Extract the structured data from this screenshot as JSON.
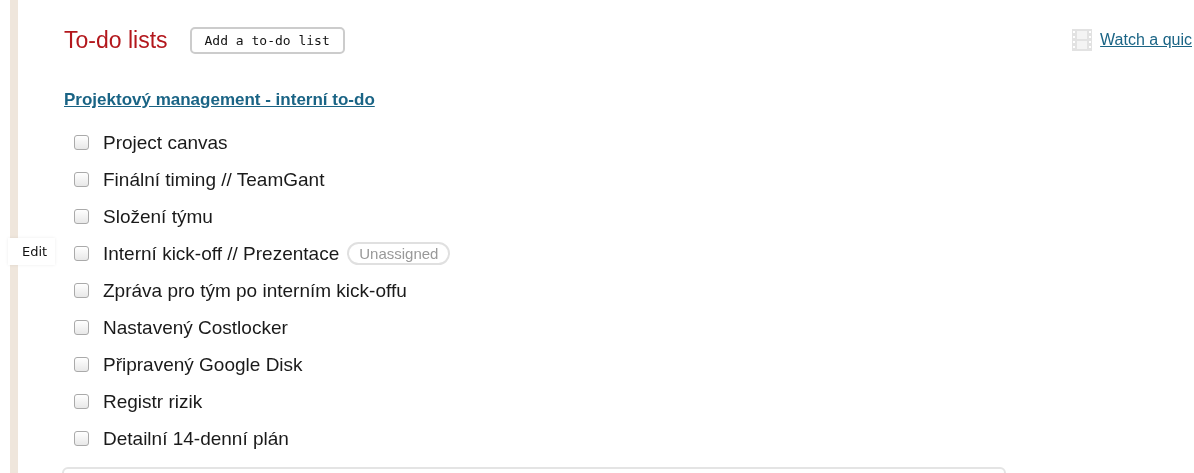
{
  "header": {
    "title": "To-do lists",
    "add_button": "Add a to-do list",
    "video_link": "Watch a quic"
  },
  "list": {
    "title": "Projektový management - interní to-do",
    "items": [
      {
        "label": "Project canvas",
        "checked": false
      },
      {
        "label": "Finální timing // TeamGant",
        "checked": false
      },
      {
        "label": "Složení týmu",
        "checked": false
      },
      {
        "label": "Interní kick-off // Prezentace",
        "checked": false,
        "badge": "Unassigned",
        "edit": "Edit"
      },
      {
        "label": "Zpráva pro tým po interním kick-offu",
        "checked": false
      },
      {
        "label": "Nastavený Costlocker",
        "checked": false
      },
      {
        "label": "Připravený Google Disk",
        "checked": false
      },
      {
        "label": "Registr rizik",
        "checked": false
      },
      {
        "label": "Detailní 14-denní plán",
        "checked": false
      }
    ]
  }
}
